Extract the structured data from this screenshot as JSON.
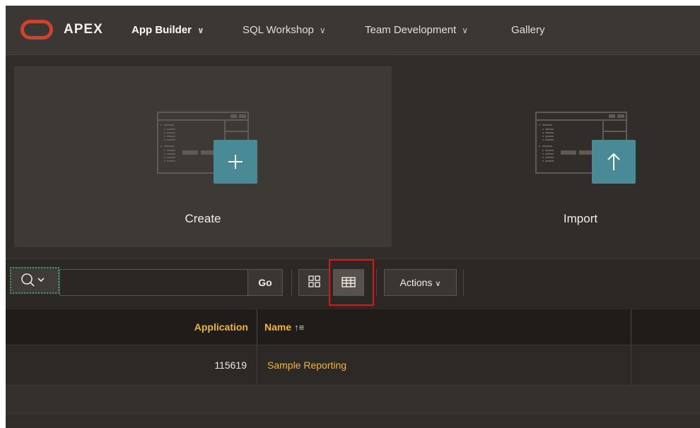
{
  "header": {
    "brand": "APEX",
    "nav": [
      {
        "label": "App Builder",
        "chevron": "chevron-down-icon",
        "active": true
      },
      {
        "label": "SQL Workshop",
        "chevron": "chevron-down-icon"
      },
      {
        "label": "Team Development",
        "chevron": "chevron-down-icon"
      },
      {
        "label": "Gallery"
      }
    ]
  },
  "cards": {
    "create": {
      "label": "Create",
      "icon": "plus-icon"
    },
    "import": {
      "label": "Import",
      "icon": "arrow-up-icon"
    }
  },
  "toolbar": {
    "search_value": "",
    "go_label": "Go",
    "actions_label": "Actions",
    "view_icon": "icon-view-icon",
    "report_icon": "report-view-icon",
    "selected_view": "report"
  },
  "report": {
    "columns": [
      {
        "label": "Application",
        "sort": "none"
      },
      {
        "label": "Name",
        "sort": "ascending"
      }
    ],
    "rows": [
      {
        "application": "115619",
        "name": "Sample Reporting"
      }
    ]
  },
  "colors": {
    "accent": "#f0b43c",
    "tile": "#4a8a96",
    "logo": "#d0412e",
    "highlight": "#e01515",
    "focus": "#3f9b5a"
  }
}
